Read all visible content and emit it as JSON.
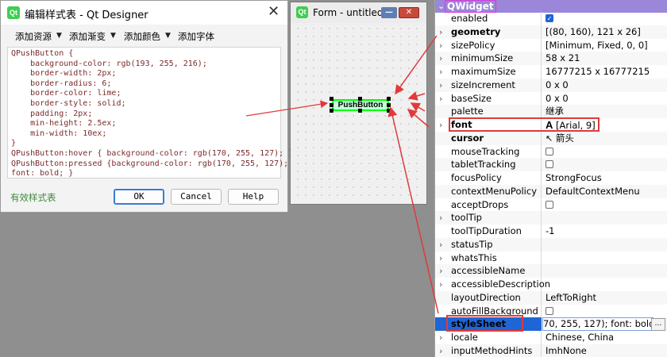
{
  "dialog": {
    "title": "编辑样式表 - Qt Designer",
    "close_symbol": "✕",
    "logo_text": "Qt",
    "toolbar": [
      "添加资源",
      "添加渐变",
      "添加颜色",
      "添加字体"
    ],
    "code_lines": [
      "QPushButton {",
      "    background-color: rgb(193, 255, 216);",
      "    border-width: 2px;",
      "    border-radius: 6;",
      "    border-color: lime;",
      "    border-style: solid;",
      "    padding: 2px;",
      "    min-height: 2.5ex;",
      "    min-width: 10ex;",
      "}",
      "QPushButton:hover { background-color: rgb(170, 255, 127); }",
      "QPushButton:pressed {background-color: rgb(170, 255, 127);",
      "font: bold; }"
    ],
    "valid_label": "有效样式表",
    "ok_label": "OK",
    "cancel_label": "Cancel",
    "help_label": "Help"
  },
  "form": {
    "title": "Form - untitled*",
    "logo_text": "Qt",
    "min_symbol": "—",
    "close_symbol": "✕",
    "button_label": "PushButton"
  },
  "props": {
    "header": "QWidget",
    "rows": [
      {
        "name": "enabled",
        "value": "",
        "checkbox": "checked",
        "expand": "",
        "bold": false
      },
      {
        "name": "geometry",
        "value": "[(80, 160), 121 x 26]",
        "checkbox": "",
        "expand": "›",
        "bold": true
      },
      {
        "name": "sizePolicy",
        "value": "[Minimum, Fixed, 0, 0]",
        "checkbox": "",
        "expand": "›",
        "bold": false
      },
      {
        "name": "minimumSize",
        "value": "58 x 21",
        "checkbox": "",
        "expand": "›",
        "bold": false
      },
      {
        "name": "maximumSize",
        "value": "16777215 x 16777215",
        "checkbox": "",
        "expand": "›",
        "bold": false
      },
      {
        "name": "sizeIncrement",
        "value": "0 x 0",
        "checkbox": "",
        "expand": "›",
        "bold": false
      },
      {
        "name": "baseSize",
        "value": "0 x 0",
        "checkbox": "",
        "expand": "›",
        "bold": false
      },
      {
        "name": "palette",
        "value": "继承",
        "checkbox": "",
        "expand": "",
        "bold": false
      },
      {
        "name": "font",
        "value": "[Arial, 9]",
        "checkbox": "",
        "expand": "›",
        "bold": true,
        "font_icon": "A"
      },
      {
        "name": "cursor",
        "value": "箭头",
        "checkbox": "",
        "expand": "",
        "bold": true,
        "cursor_icon": "↖"
      },
      {
        "name": "mouseTracking",
        "value": "",
        "checkbox": "unchecked",
        "expand": "",
        "bold": false
      },
      {
        "name": "tabletTracking",
        "value": "",
        "checkbox": "unchecked",
        "expand": "",
        "bold": false
      },
      {
        "name": "focusPolicy",
        "value": "StrongFocus",
        "checkbox": "",
        "expand": "",
        "bold": false
      },
      {
        "name": "contextMenuPolicy",
        "value": "DefaultContextMenu",
        "checkbox": "",
        "expand": "",
        "bold": false
      },
      {
        "name": "acceptDrops",
        "value": "",
        "checkbox": "unchecked",
        "expand": "",
        "bold": false
      },
      {
        "name": "toolTip",
        "value": "",
        "checkbox": "",
        "expand": "›",
        "bold": false
      },
      {
        "name": "toolTipDuration",
        "value": "-1",
        "checkbox": "",
        "expand": "",
        "bold": false
      },
      {
        "name": "statusTip",
        "value": "",
        "checkbox": "",
        "expand": "›",
        "bold": false
      },
      {
        "name": "whatsThis",
        "value": "",
        "checkbox": "",
        "expand": "›",
        "bold": false
      },
      {
        "name": "accessibleName",
        "value": "",
        "checkbox": "",
        "expand": "›",
        "bold": false
      },
      {
        "name": "accessibleDescription",
        "value": "",
        "checkbox": "",
        "expand": "›",
        "bold": false
      },
      {
        "name": "layoutDirection",
        "value": "LeftToRight",
        "checkbox": "",
        "expand": "",
        "bold": false
      },
      {
        "name": "autoFillBackground",
        "value": "",
        "checkbox": "unchecked",
        "expand": "",
        "bold": false
      },
      {
        "name": "styleSheet",
        "value": "70, 255, 127); font: bold; }",
        "checkbox": "",
        "expand": "",
        "bold": true,
        "selected": true
      },
      {
        "name": "locale",
        "value": "Chinese, China",
        "checkbox": "",
        "expand": "›",
        "bold": false
      },
      {
        "name": "inputMethodHints",
        "value": "ImhNone",
        "checkbox": "",
        "expand": "›",
        "bold": false
      }
    ],
    "more_symbol": "…"
  },
  "colors": {
    "accent_red": "#e03a3a",
    "header_purple": "#9b87d9",
    "selection_blue": "#1e66d6",
    "button_green_bg": "#c1ffd8",
    "button_border": "#00ff00"
  }
}
